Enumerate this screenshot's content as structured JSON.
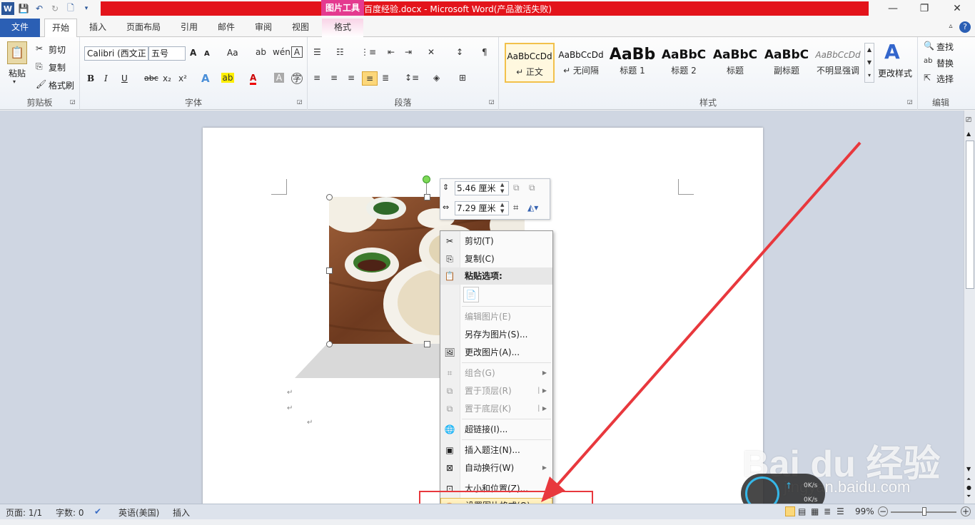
{
  "window": {
    "title": "百度经验.docx - Microsoft Word(产品激活失败)",
    "context_tab_header": "图片工具",
    "minimize": "—",
    "restore": "❐",
    "close": "✕"
  },
  "tabs": [
    "文件",
    "开始",
    "插入",
    "页面布局",
    "引用",
    "邮件",
    "审阅",
    "视图",
    "格式"
  ],
  "ribbon": {
    "clipboard": {
      "paste": "粘贴",
      "cut": "剪切",
      "copy": "复制",
      "format_painter": "格式刷",
      "label": "剪贴板"
    },
    "font": {
      "font_name": "Calibri (西文正",
      "font_size": "五号",
      "label": "字体",
      "bold": "B",
      "italic": "I",
      "underline": "U",
      "strike": "abc",
      "grow": "A",
      "shrink": "A",
      "case": "Aa",
      "clear": "A",
      "font_color": "A"
    },
    "paragraph": {
      "label": "段落"
    },
    "styles": {
      "label": "样式",
      "items": [
        {
          "sample": "AaBbCcDd",
          "name": "↵ 正文"
        },
        {
          "sample": "AaBbCcDd",
          "name": "↵ 无间隔"
        },
        {
          "sample": "AaBb",
          "name": "标题 1"
        },
        {
          "sample": "AaBbC",
          "name": "标题 2"
        },
        {
          "sample": "AaBbC",
          "name": "标题"
        },
        {
          "sample": "AaBbC",
          "name": "副标题"
        },
        {
          "sample": "AaBbCcDd",
          "name": "不明显强调"
        }
      ],
      "change_styles": "更改样式"
    },
    "editing": {
      "find": "查找",
      "replace": "替换",
      "select": "选择",
      "label": "编辑"
    }
  },
  "mini_toolbar": {
    "height_value": "5.46 厘米",
    "width_value": "7.29 厘米"
  },
  "context_menu": {
    "cut": "剪切(T)",
    "copy": "复制(C)",
    "paste_options": "粘贴选项:",
    "edit_picture": "编辑图片(E)",
    "save_as_picture": "另存为图片(S)...",
    "change_picture": "更改图片(A)...",
    "group": "组合(G)",
    "bring_to_front": "置于顶层(R)",
    "send_to_back": "置于底层(K)",
    "hyperlink": "超链接(I)...",
    "insert_caption": "插入题注(N)...",
    "wrap_text": "自动换行(W)",
    "size_position": "大小和位置(Z)...",
    "format_picture": "设置图片格式(O)..."
  },
  "statusbar": {
    "page": "页面: 1/1",
    "words": "字数: 0",
    "language": "英语(美国)",
    "mode": "插入",
    "zoom": "99%",
    "net_up": "0K/s",
    "net_down": "0K/s"
  },
  "watermark": {
    "brand": "Bai du 经验",
    "url": "jingyan.baidu.com"
  },
  "colors": {
    "accent": "#2b5fb4",
    "title_bar": "#e3141b",
    "context_tab": "#e43a8f",
    "highlight": "#e8383d"
  }
}
